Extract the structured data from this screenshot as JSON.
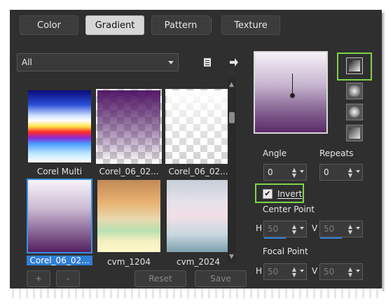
{
  "tabs": [
    {
      "label": "Color"
    },
    {
      "label": "Gradient"
    },
    {
      "label": "Pattern"
    },
    {
      "label": "Texture"
    }
  ],
  "category": {
    "value": "All"
  },
  "gradients": [
    {
      "name": "Corel Multi"
    },
    {
      "name": "Corel_06_02..."
    },
    {
      "name": "Corel_06_02..."
    },
    {
      "name": "Corel_06_02..."
    },
    {
      "name": "cvm_1204"
    },
    {
      "name": "cvm_2024"
    }
  ],
  "controls": {
    "angle_label": "Angle",
    "angle_value": "0",
    "repeats_label": "Repeats",
    "repeats_value": "0",
    "invert_label": "Invert",
    "invert_checked": true,
    "center_label": "Center Point",
    "focal_label": "Focal Point",
    "h_label": "H",
    "v_label": "V",
    "center_h": "50",
    "center_v": "50",
    "focal_h": "50",
    "focal_v": "50"
  },
  "bottom": {
    "add": "+",
    "remove": "-",
    "reset": "Reset",
    "save": "Save"
  },
  "colors": {
    "highlight": "#7fd348",
    "selection": "#2f7fd6"
  }
}
